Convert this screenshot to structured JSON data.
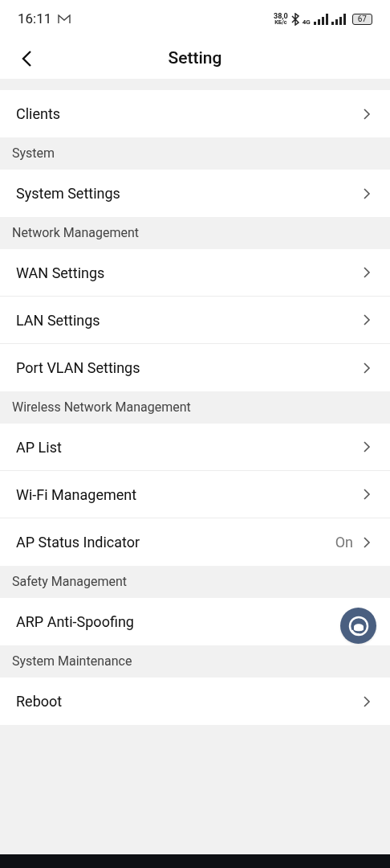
{
  "status_bar": {
    "time": "16:11",
    "speed_value": "38,0",
    "speed_unit": "КБ/с",
    "network": "4G",
    "battery": "67"
  },
  "header": {
    "title": "Setting"
  },
  "groups": [
    {
      "items": [
        {
          "kind": "link",
          "label": "Clients"
        }
      ]
    },
    {
      "header": "System",
      "items": [
        {
          "kind": "link",
          "label": "System Settings"
        }
      ]
    },
    {
      "header": "Network Management",
      "items": [
        {
          "kind": "link",
          "label": "WAN Settings"
        },
        {
          "kind": "link",
          "label": "LAN Settings"
        },
        {
          "kind": "link",
          "label": "Port VLAN Settings"
        }
      ]
    },
    {
      "header": "Wireless Network Management",
      "items": [
        {
          "kind": "link",
          "label": "AP List"
        },
        {
          "kind": "link",
          "label": "Wi-Fi Management"
        },
        {
          "kind": "link",
          "label": "AP Status Indicator",
          "value": "On"
        }
      ]
    },
    {
      "header": "Safety Management",
      "items": [
        {
          "kind": "plain",
          "label": "ARP Anti-Spoofing"
        }
      ]
    },
    {
      "header": "System Maintenance",
      "items": [
        {
          "kind": "link",
          "label": "Reboot"
        }
      ]
    }
  ]
}
